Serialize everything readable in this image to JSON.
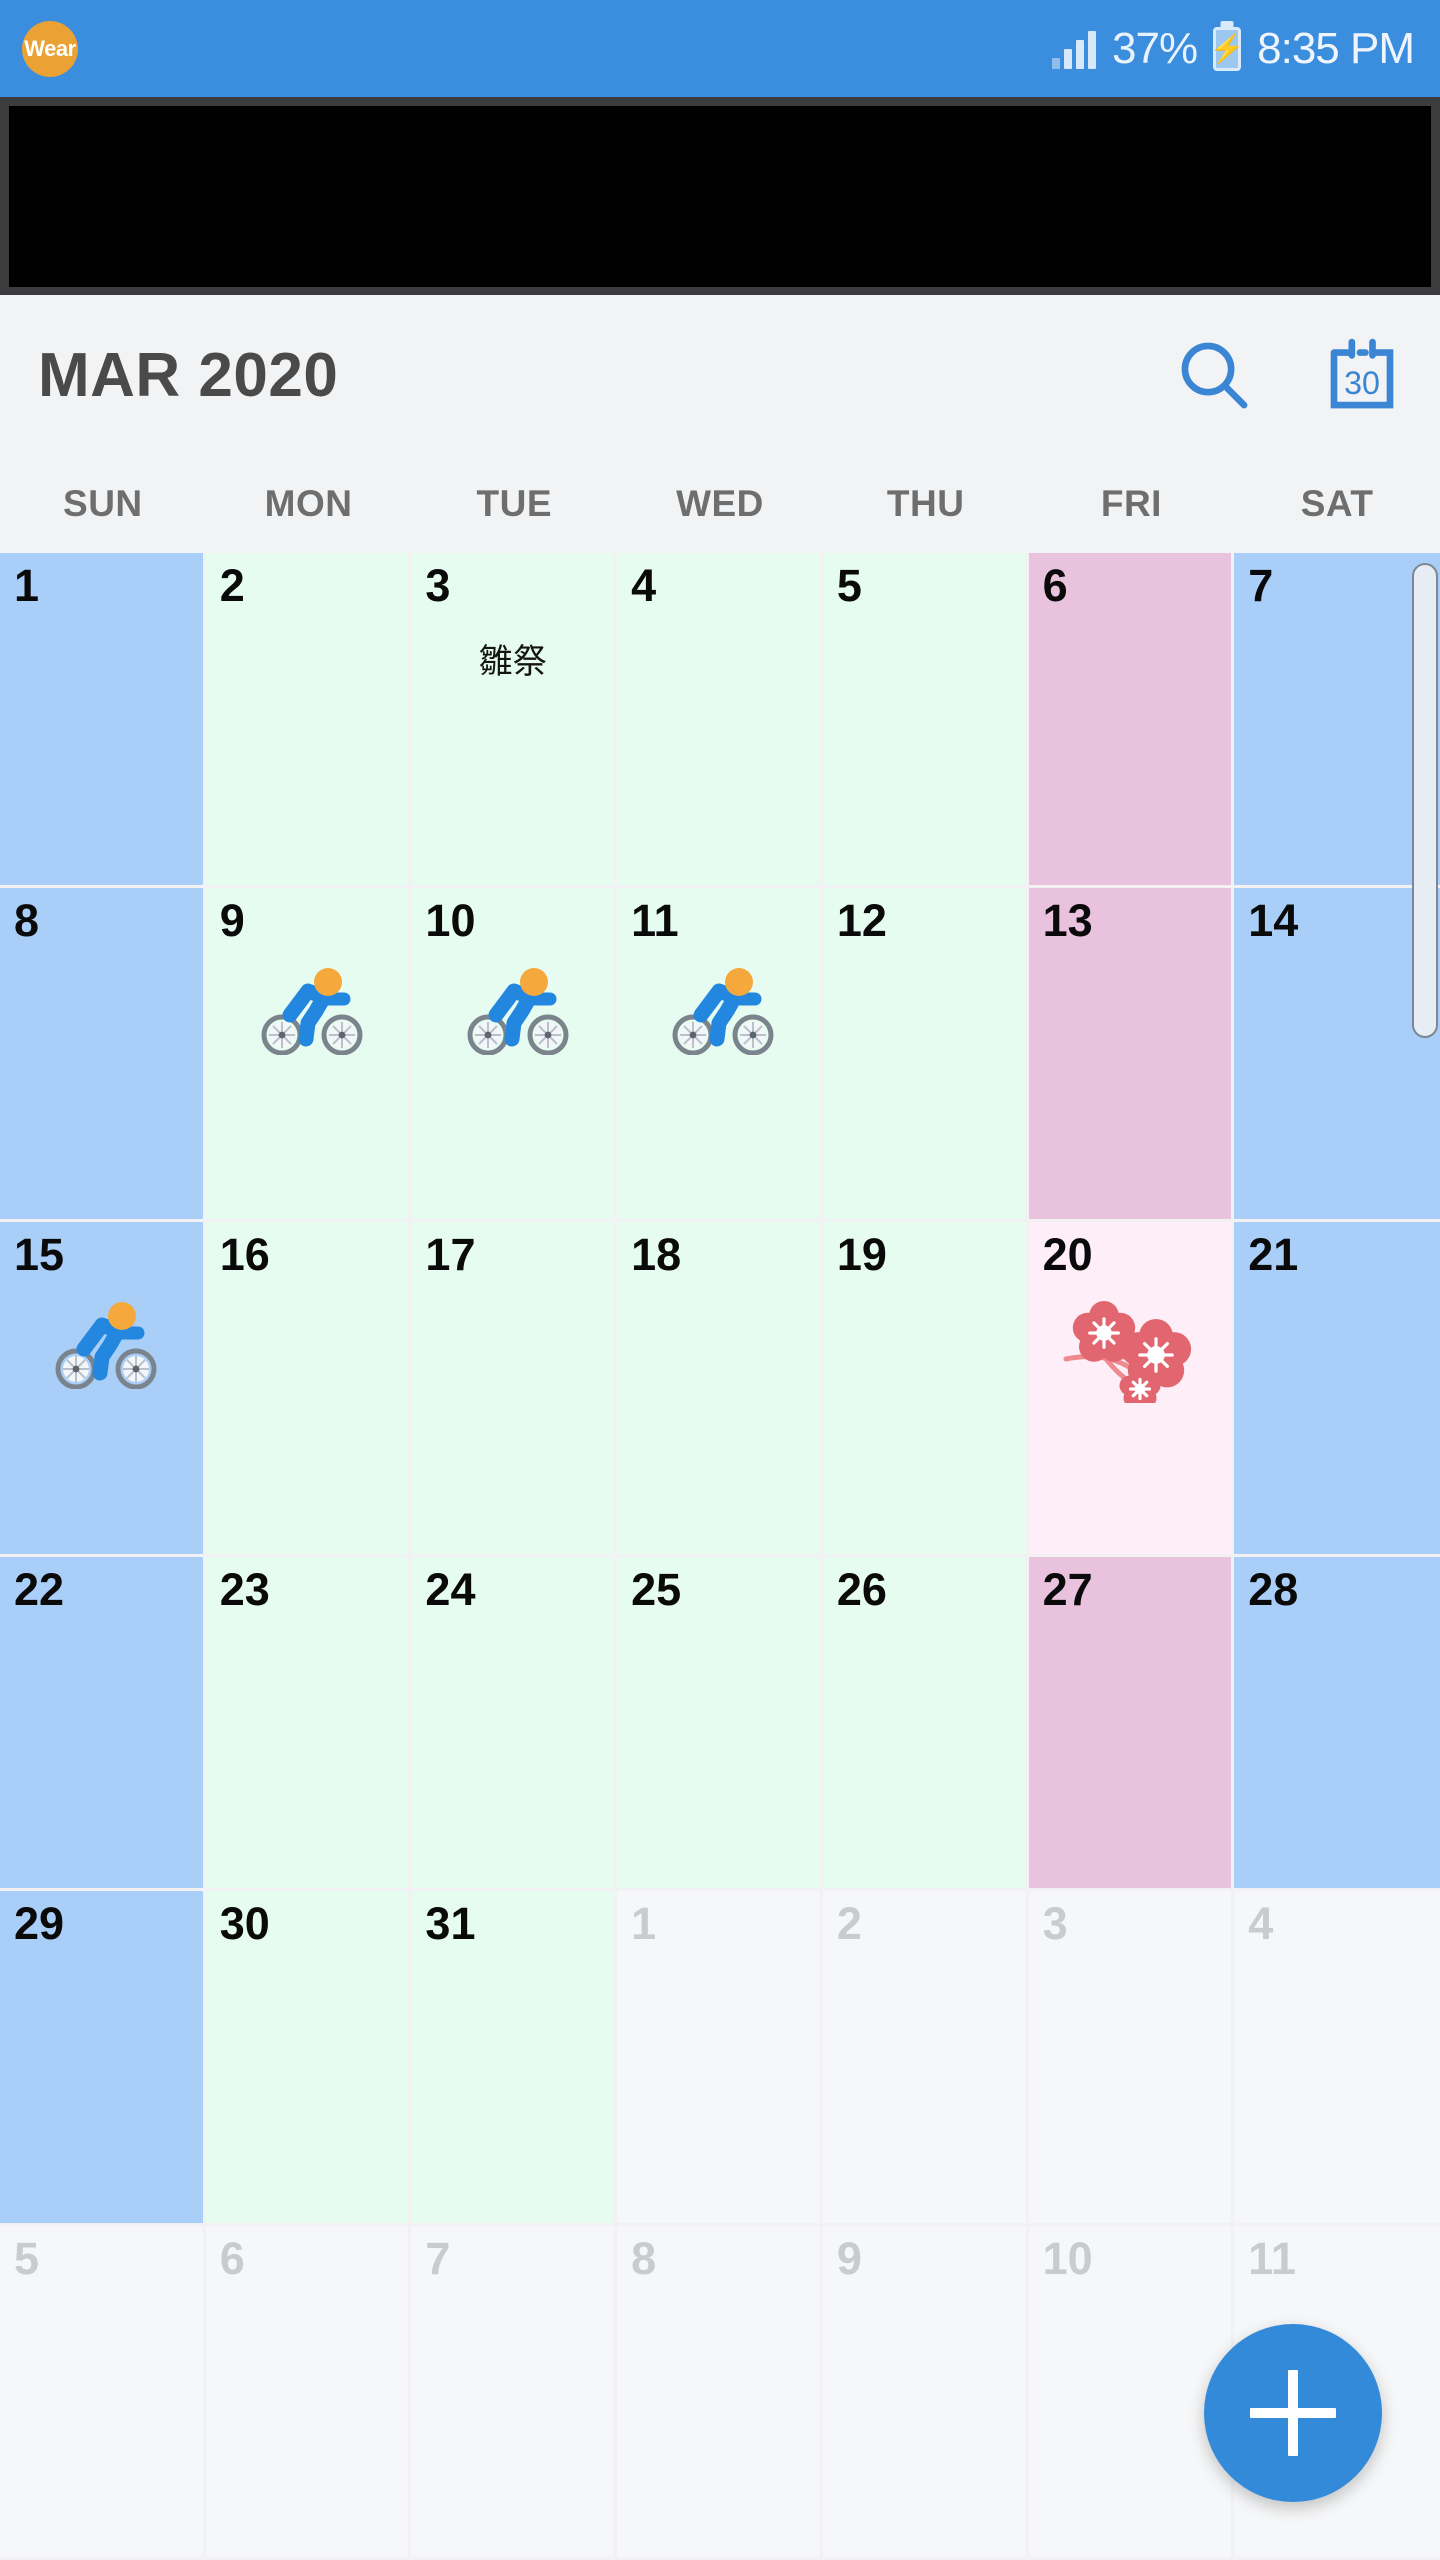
{
  "status_bar": {
    "wear_badge": "Wear",
    "battery_percent": "37%",
    "time": "8:35 PM",
    "bg_color": "#3b8ddd"
  },
  "ad_banner": {
    "present": true
  },
  "app_bar": {
    "title": "MAR 2020",
    "search_icon": "search-icon",
    "today_icon_label": "30"
  },
  "weekdays": [
    "SUN",
    "MON",
    "TUE",
    "WED",
    "THU",
    "FRI",
    "SAT"
  ],
  "colors": {
    "weekend_blue": "#a9cef8",
    "weekday_green": "#e7fcf0",
    "friday_pink": "#e9c2dd",
    "holiday_pink": "#fdeef7",
    "other_month": "#f6f7f8",
    "accent": "#338ad8",
    "title_text": "#4a4a4a",
    "weekday_text": "#6e6e6e"
  },
  "fab": {
    "label": "+",
    "name": "add-event-button"
  },
  "weeks": [
    [
      {
        "day": "1",
        "type": "sun"
      },
      {
        "day": "2",
        "type": "wk"
      },
      {
        "day": "3",
        "type": "wk",
        "event": "雛祭"
      },
      {
        "day": "4",
        "type": "wk"
      },
      {
        "day": "5",
        "type": "wk"
      },
      {
        "day": "6",
        "type": "fri"
      },
      {
        "day": "7",
        "type": "sat"
      }
    ],
    [
      {
        "day": "8",
        "type": "sun"
      },
      {
        "day": "9",
        "type": "wk",
        "emoji": "cyclist"
      },
      {
        "day": "10",
        "type": "wk",
        "emoji": "cyclist"
      },
      {
        "day": "11",
        "type": "wk",
        "emoji": "cyclist"
      },
      {
        "day": "12",
        "type": "wk"
      },
      {
        "day": "13",
        "type": "fri"
      },
      {
        "day": "14",
        "type": "sat"
      }
    ],
    [
      {
        "day": "15",
        "type": "sun",
        "emoji": "cyclist"
      },
      {
        "day": "16",
        "type": "wk"
      },
      {
        "day": "17",
        "type": "wk"
      },
      {
        "day": "18",
        "type": "wk"
      },
      {
        "day": "19",
        "type": "wk"
      },
      {
        "day": "20",
        "type": "holiday",
        "emoji": "cherry-blossom"
      },
      {
        "day": "21",
        "type": "sat"
      }
    ],
    [
      {
        "day": "22",
        "type": "sun"
      },
      {
        "day": "23",
        "type": "wk"
      },
      {
        "day": "24",
        "type": "wk"
      },
      {
        "day": "25",
        "type": "wk"
      },
      {
        "day": "26",
        "type": "wk"
      },
      {
        "day": "27",
        "type": "fri"
      },
      {
        "day": "28",
        "type": "sat"
      }
    ],
    [
      {
        "day": "29",
        "type": "sun"
      },
      {
        "day": "30",
        "type": "wk"
      },
      {
        "day": "31",
        "type": "wk"
      },
      {
        "day": "1",
        "type": "other"
      },
      {
        "day": "2",
        "type": "other"
      },
      {
        "day": "3",
        "type": "other"
      },
      {
        "day": "4",
        "type": "other"
      }
    ],
    [
      {
        "day": "5",
        "type": "other"
      },
      {
        "day": "6",
        "type": "other"
      },
      {
        "day": "7",
        "type": "other"
      },
      {
        "day": "8",
        "type": "other"
      },
      {
        "day": "9",
        "type": "other"
      },
      {
        "day": "10",
        "type": "other"
      },
      {
        "day": "11",
        "type": "other"
      }
    ]
  ]
}
